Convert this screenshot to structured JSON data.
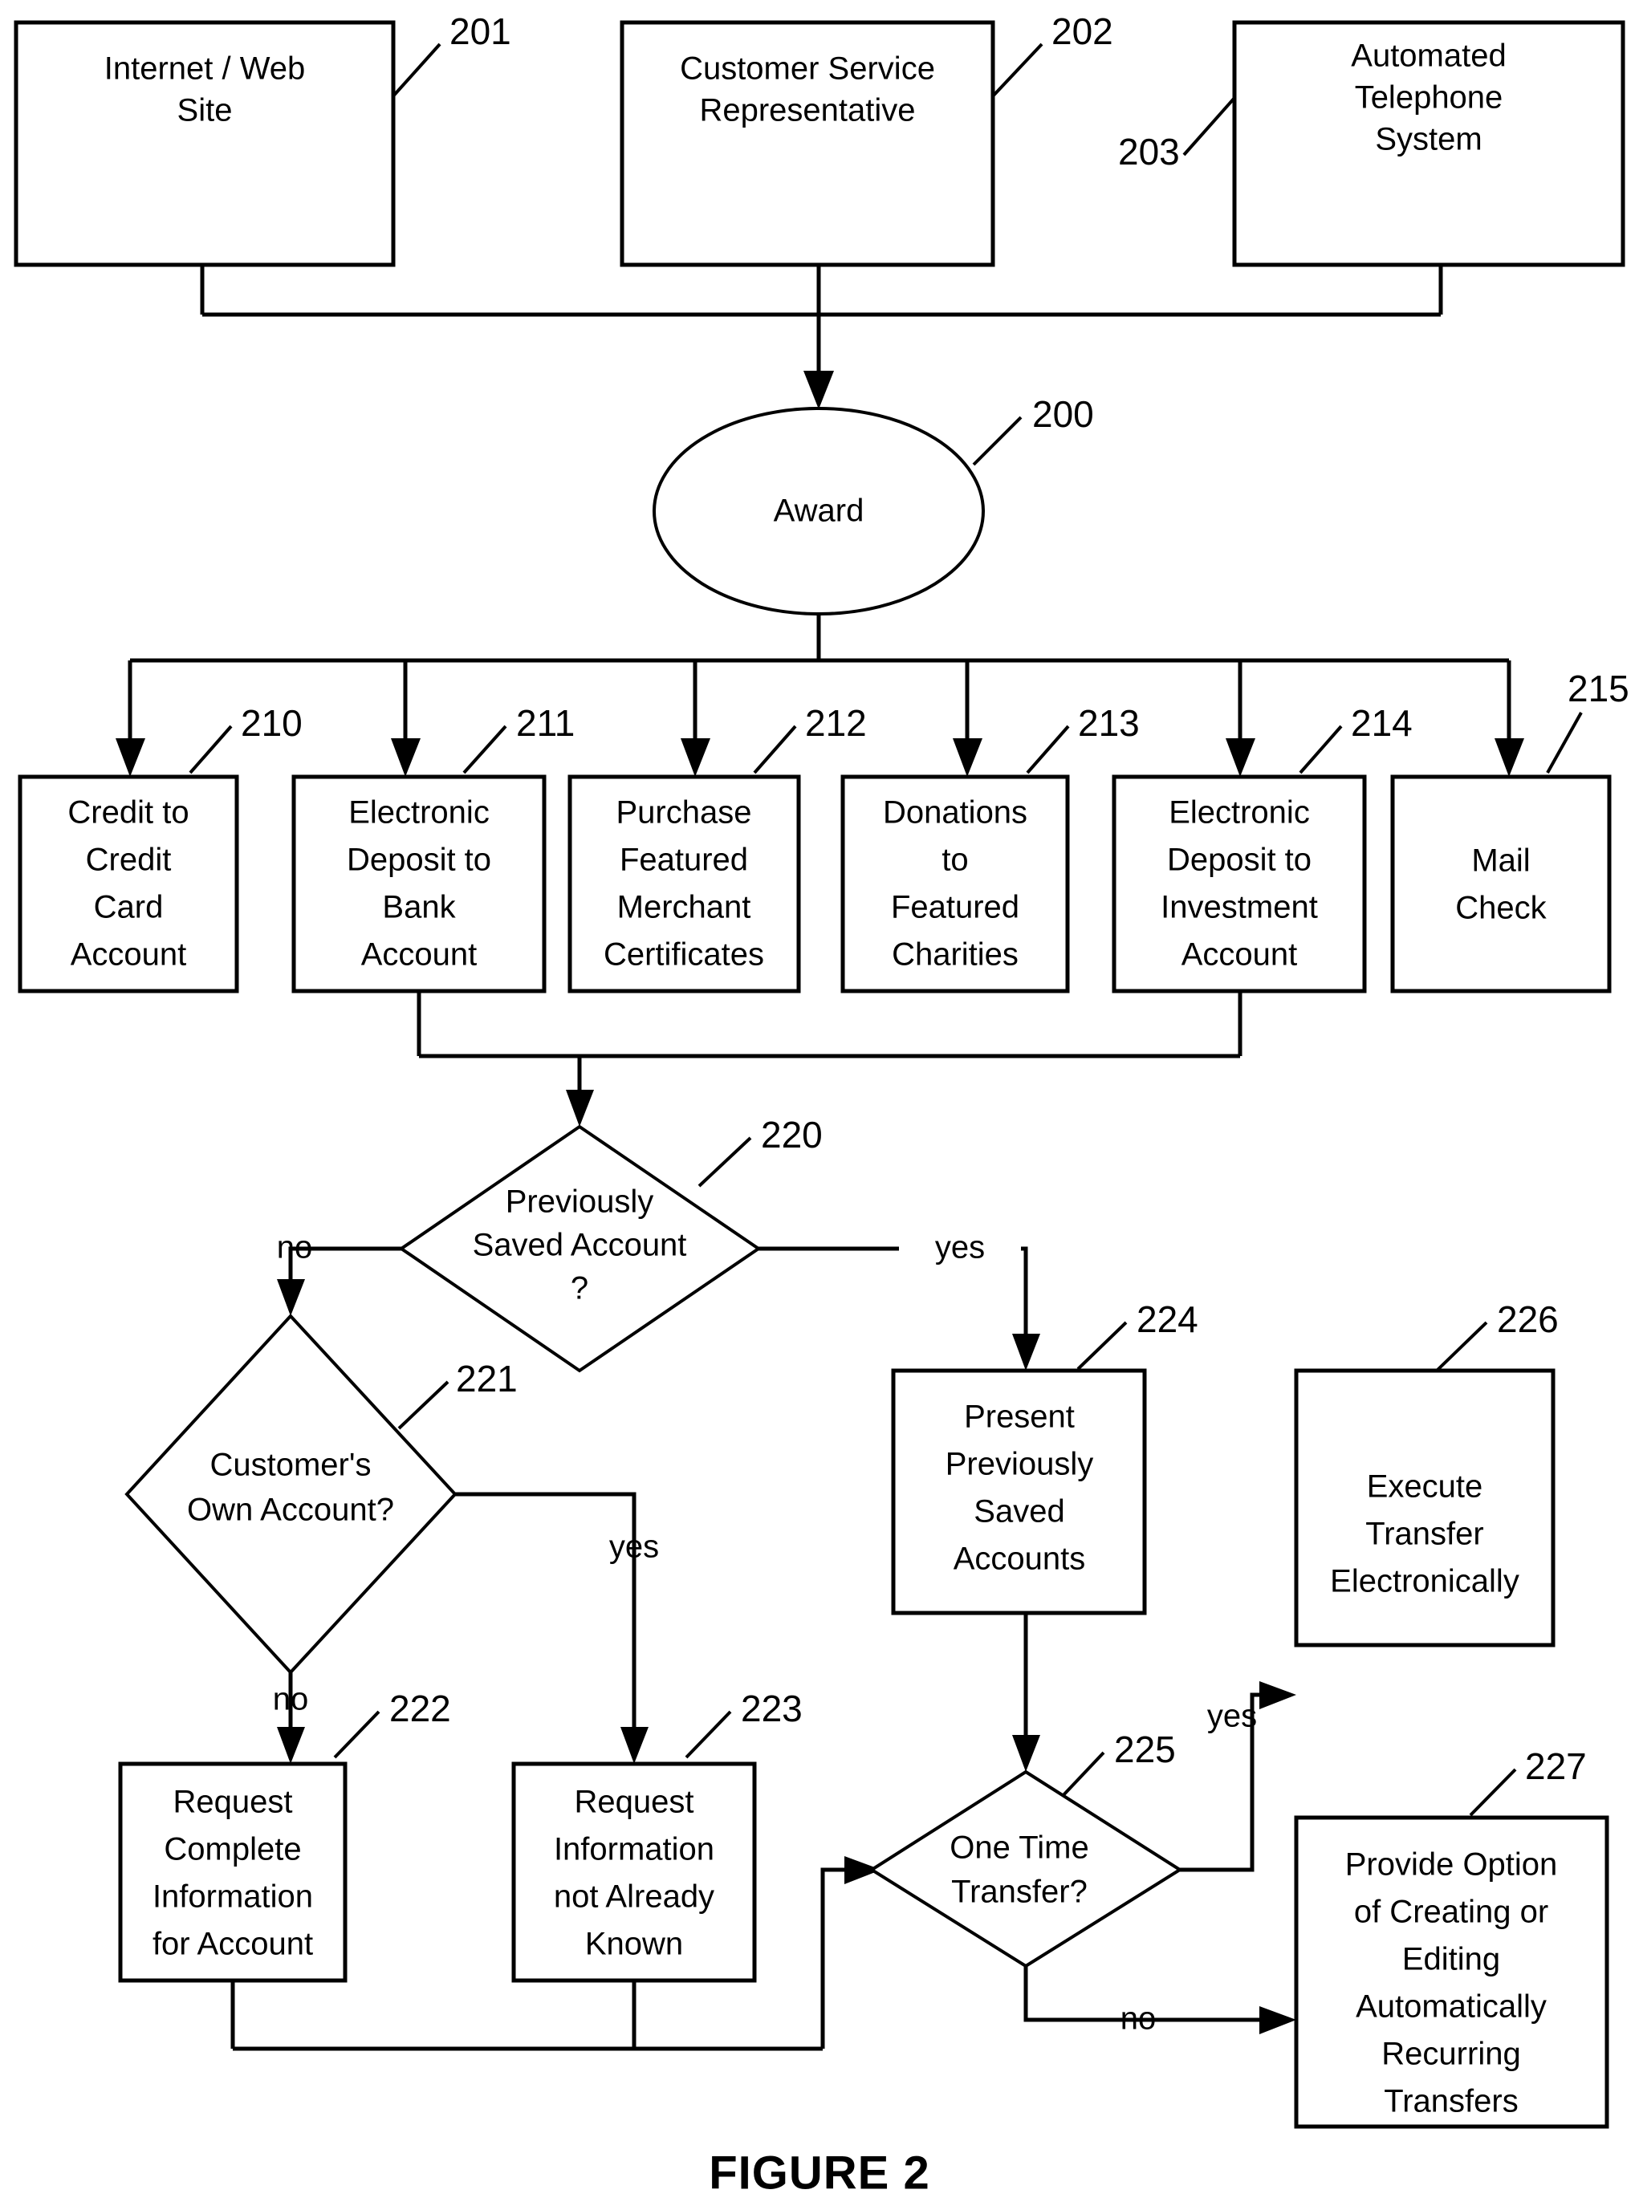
{
  "figure": {
    "caption": "FIGURE 2",
    "title": "Award redemption method flowchart"
  },
  "nodes": {
    "n201": {
      "ref": "201",
      "shape": "box",
      "lines": [
        "Internet / Web",
        "Site"
      ]
    },
    "n202": {
      "ref": "202",
      "shape": "box",
      "lines": [
        "Customer Service",
        "Representative"
      ]
    },
    "n203": {
      "ref": "203",
      "shape": "box",
      "lines": [
        "Automated",
        "Telephone",
        "System"
      ]
    },
    "n200": {
      "ref": "200",
      "shape": "ellipse",
      "lines": [
        "Award"
      ]
    },
    "n210": {
      "ref": "210",
      "shape": "box",
      "lines": [
        "Credit to",
        "Credit",
        "Card",
        "Account"
      ]
    },
    "n211": {
      "ref": "211",
      "shape": "box",
      "lines": [
        "Electronic",
        "Deposit to",
        "Bank",
        "Account"
      ]
    },
    "n212": {
      "ref": "212",
      "shape": "box",
      "lines": [
        "Purchase",
        "Featured",
        "Merchant",
        "Certificates"
      ]
    },
    "n213": {
      "ref": "213",
      "shape": "box",
      "lines": [
        "Donations",
        "to",
        "Featured",
        "Charities"
      ]
    },
    "n214": {
      "ref": "214",
      "shape": "box",
      "lines": [
        "Electronic",
        "Deposit to",
        "Investment",
        "Account"
      ]
    },
    "n215": {
      "ref": "215",
      "shape": "box",
      "lines": [
        "Mail",
        "Check"
      ]
    },
    "n220": {
      "ref": "220",
      "shape": "diamond",
      "lines": [
        "Previously",
        "Saved Account",
        "?"
      ]
    },
    "n221": {
      "ref": "221",
      "shape": "diamond",
      "lines": [
        "Customer's",
        "Own Account?"
      ]
    },
    "n222": {
      "ref": "222",
      "shape": "box",
      "lines": [
        "Request",
        "Complete",
        "Information",
        "for Account"
      ]
    },
    "n223": {
      "ref": "223",
      "shape": "box",
      "lines": [
        "Request",
        "Information",
        "not Already",
        "Known"
      ]
    },
    "n224": {
      "ref": "224",
      "shape": "box",
      "lines": [
        "Present",
        "Previously",
        "Saved",
        "Accounts"
      ]
    },
    "n225": {
      "ref": "225",
      "shape": "diamond",
      "lines": [
        "One Time",
        "Transfer?"
      ]
    },
    "n226": {
      "ref": "226",
      "shape": "box",
      "lines": [
        "Execute",
        "Transfer",
        "Electronically"
      ]
    },
    "n227": {
      "ref": "227",
      "shape": "box",
      "lines": [
        "Provide Option",
        "of Creating or",
        "Editing",
        "Automatically",
        "Recurring",
        "Transfers"
      ]
    }
  },
  "edge_labels": {
    "e220_no": "no",
    "e220_yes": "yes",
    "e221_yes": "yes",
    "e221_no": "no",
    "e225_yes": "yes",
    "e225_no": "no"
  },
  "edges": [
    {
      "from": "201",
      "to": "200",
      "label": ""
    },
    {
      "from": "202",
      "to": "200",
      "label": ""
    },
    {
      "from": "203",
      "to": "200",
      "label": ""
    },
    {
      "from": "200",
      "to": "210",
      "label": ""
    },
    {
      "from": "200",
      "to": "211",
      "label": ""
    },
    {
      "from": "200",
      "to": "212",
      "label": ""
    },
    {
      "from": "200",
      "to": "213",
      "label": ""
    },
    {
      "from": "200",
      "to": "214",
      "label": ""
    },
    {
      "from": "200",
      "to": "215",
      "label": ""
    },
    {
      "from": "211",
      "to": "220",
      "label": ""
    },
    {
      "from": "214",
      "to": "220",
      "label": ""
    },
    {
      "from": "220",
      "to": "221",
      "label": "no"
    },
    {
      "from": "220",
      "to": "224",
      "label": "yes"
    },
    {
      "from": "221",
      "to": "222",
      "label": "no"
    },
    {
      "from": "221",
      "to": "223",
      "label": "yes"
    },
    {
      "from": "222",
      "to": "225",
      "label": ""
    },
    {
      "from": "223",
      "to": "225",
      "label": ""
    },
    {
      "from": "224",
      "to": "225",
      "label": ""
    },
    {
      "from": "225",
      "to": "226",
      "label": "yes"
    },
    {
      "from": "225",
      "to": "227",
      "label": "no"
    }
  ],
  "colors": {
    "background": "#ffffff",
    "stroke": "#000000",
    "text": "#000000"
  }
}
